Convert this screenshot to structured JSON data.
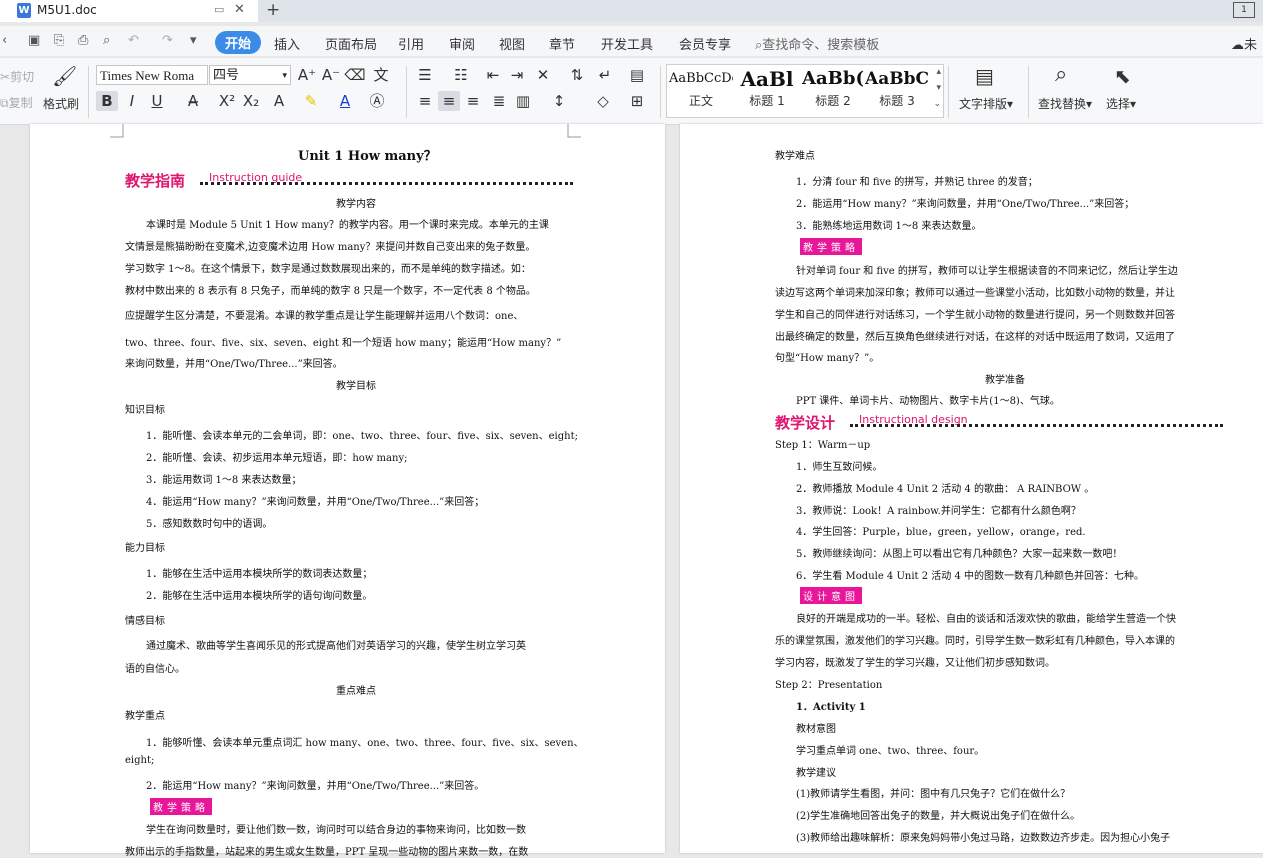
{
  "tab": {
    "title": "M5U1.doc",
    "win_label": "1"
  },
  "menu": {
    "items": [
      "开始",
      "插入",
      "页面布局",
      "引用",
      "审阅",
      "视图",
      "章节",
      "开发工具",
      "会员专享"
    ],
    "search": "查找命令、搜索模板",
    "cloud": "未"
  },
  "ribbon": {
    "cut": "剪切",
    "copy": "复制",
    "painter": "格式刷",
    "font_name": "Times New Roma",
    "font_size": "四号",
    "text_layout": "文字排版",
    "find_replace": "查找替换",
    "select": "选择"
  },
  "styles": [
    {
      "sample": "AaBbCcDd",
      "label": "正文"
    },
    {
      "sample": "AaBl",
      "label": "标题 1"
    },
    {
      "sample": "AaBb(",
      "label": "标题 2"
    },
    {
      "sample": "AaBbC",
      "label": "标题 3"
    }
  ],
  "left": {
    "title": "Unit 1 How many？",
    "h1": "教学指南",
    "h1_en": "Instruction guide",
    "sec1": "教学内容",
    "p1": [
      "本课时是 Module 5 Unit 1 How many？的教学内容。用一个课时来完成。本单元的主课",
      "文情景是熊猫盼盼在变魔术,边变魔术边用 How many？来提问并数自己变出来的兔子数量。",
      "学习数字 1～8。在这个情景下，数字是通过数数展现出来的，而不是单纯的数字描述。如：",
      "教材中数出来的 8 表示有 8 只兔子，而单纯的数字 8 只是一个数字，不一定代表 8 个物品。",
      "应提醒学生区分清楚，不要混淆。本课的教学重点是让学生能理解并运用八个数词：one、",
      "two、three、four、five、six、seven、eight 和一个短语 how many；能运用“How many？”",
      "来询问数量，并用“One/Two/Three...”来回答。"
    ],
    "sec2": "教学目标",
    "k": "知识目标",
    "k_items": [
      "1．能听懂、会读本单元的二会单词，即：one、two、three、four、five、six、seven、eight;",
      "2．能听懂、会读、初步运用本单元短语，即：how many;",
      "3．能运用数词 1～8 来表达数量；",
      "4．能运用“How many？”来询问数量，并用“One/Two/Three...”来回答；",
      "5．感知数数时句中的语调。"
    ],
    "a": "能力目标",
    "a_items": [
      "1．能够在生活中运用本模块所学的数词表达数量；",
      "2．能够在生活中运用本模块所学的语句询问数量。"
    ],
    "e": "情感目标",
    "e_p": [
      "通过魔术、歌曲等学生喜闻乐见的形式提高他们对英语学习的兴趣，使学生树立学习英",
      "语的自信心。"
    ],
    "sec3": "重点难点",
    "kp": "教学重点",
    "kp_items": [
      "1．能够听懂、会读本单元重点词汇 how many、one、two、three、four、five、six、seven、",
      "eight;",
      "2．能运用“How many？”来询问数量，并用“One/Two/Three...”来回答。"
    ],
    "badge": "教学策略",
    "last": [
      "学生在询问数量时，要让他们数一数，询问时可以结合身边的事物来询问，比如数一数",
      "教师出示的手指数量，站起来的男生或女生数量，PPT 呈现一些动物的图片来数一数，在数"
    ]
  },
  "right": {
    "d": "教学难点",
    "d_items": [
      "1．分清 four 和 five 的拼写，并熟记 three 的发音；",
      "2．能运用“How many？”来询问数量，并用“One/Two/Three...”来回答；",
      "3．能熟练地运用数词 1～8 来表达数量。"
    ],
    "badge1": "教学策略",
    "s_p": [
      "针对单词 four 和 five 的拼写，教师可以让学生根据读音的不同来记忆，然后让学生边",
      "读边写这两个单词来加深印象；教师可以通过一些课堂小活动，比如数小动物的数量，并让",
      "学生和自己的同伴进行对话练习，一个学生就小动物的数量进行提问，另一个则数数并回答",
      "出最终确定的数量，然后互换角色继续进行对话，在这样的对话中既运用了数词，又运用了",
      "句型“How many？”。"
    ],
    "prep": "教学准备",
    "prep_p": "PPT 课件、单词卡片、动物图片、数字卡片(1～8)、气球。",
    "h1": "教学设计",
    "h1_en": "Instructional design",
    "step1": "Step 1：Warm－up",
    "s1_items": [
      "1．师生互致问候。",
      "2．教师播放 Module 4 Unit 2 活动 4 的歌曲：  A RAINBOW  。",
      "3．教师说：Look！A rainbow.并问学生：它都有什么颜色啊？",
      "4．学生回答：Purple，blue，green，yellow，orange，red.",
      "5．教师继续询问：从图上可以看出它有几种颜色？大家一起来数一数吧！",
      "6．学生看 Module 4 Unit 2 活动 4 中的图数一数有几种颜色并回答：七种。"
    ],
    "badge2": "设计意图",
    "i_p": [
      "良好的开端是成功的一半。轻松、自由的谈话和活泼欢快的歌曲，能给学生营造一个快",
      "乐的课堂氛围，激发他们的学习兴趣。同时，引导学生数一数彩虹有几种颜色，导入本课的",
      "学习内容，既激发了学生的学习兴趣，又让他们初步感知数词。"
    ],
    "step2": "Step 2：Presentation",
    "act": "1．Activity 1",
    "m": "教材意图",
    "m_p": "学习重点单词 one、two、three、four。",
    "sug": "教学建议",
    "sug_items": [
      "(1)教师请学生看图，并问：图中有几只兔子？它们在做什么？",
      "(2)学生准确地回答出兔子的数量，并大概说出兔子们在做什么。",
      "(3)教师给出趣味解析：原来兔妈妈带小兔过马路，边数数边齐步走。因为担心小兔子"
    ]
  }
}
